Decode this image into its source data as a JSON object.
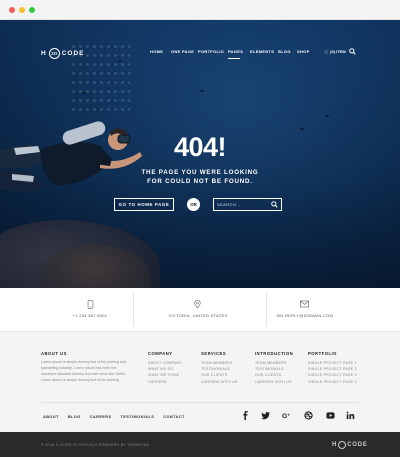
{
  "window": {
    "controls": [
      "close",
      "minimize",
      "maximize"
    ]
  },
  "colors": {
    "close": "#f25f58",
    "minimize": "#fbbe2e",
    "maximize": "#37c840",
    "accent": "#ffffff",
    "footer_bg": "#f4f4f4",
    "bottombar_bg": "#2a2a2a"
  },
  "header": {
    "logo_left": "H",
    "logo_mid": "2O",
    "logo_right": "CODE",
    "nav": [
      "HOME",
      "ONE PAGE",
      "PORTFOLIO",
      "PAGES",
      "ELEMENTS",
      "BLOG",
      "SHOP"
    ],
    "active_nav": "PAGES",
    "cart_label": "(0) ITEM"
  },
  "hero": {
    "title": "404!",
    "subtitle_line1": "THE PAGE YOU WERE LOOKING",
    "subtitle_line2": "FOR COULD NOT BE FOUND.",
    "home_button": "GO TO HOME PAGE",
    "or_label": "OR",
    "search_placeholder": "SEARCH..."
  },
  "contact": {
    "phone": "+1 234 567 8901",
    "address": "VICTORIA, UNITED STATES",
    "email": "NO-REPLY@DOMAIN.COM"
  },
  "footer": {
    "about_heading": "ABOUT US",
    "about_text": "Lorem Ipsum is simply dummy text of the printing and typesetting industry. Lorem Ipsum has been the industry's standard dummy text ever since the 1500s. Lorem Ipsum is simply dummy text of the printing",
    "columns": [
      {
        "heading": "COMPANY",
        "links": [
          "ABOUT COMPANY",
          "WHAT WE DO",
          "WHAT WE THINK",
          "CAREERS"
        ]
      },
      {
        "heading": "SERVICES",
        "links": [
          "TEAM MEMBERS",
          "TESTIMONIALS",
          "OUR CLIENTS",
          "CAREERS WITH US"
        ]
      },
      {
        "heading": "INTRODUCTION",
        "links": [
          "TEAM MEMBERS",
          "TESTIMONIALS",
          "OUR CLIENTS",
          "CAREERS WITH US"
        ]
      },
      {
        "heading": "PORTFOLIO",
        "links": [
          "SINGLE PROJECT PAGE 1",
          "SINGLE PROJECT PAGE 2",
          "SINGLE PROJECT PAGE 3",
          "SINGLE PROJECT PAGE 4"
        ]
      }
    ],
    "bottom_nav": [
      "ABOUT",
      "BLOG",
      "CAREERS",
      "TESTIMONIALS",
      "CONTACT"
    ],
    "socials": [
      "facebook-icon",
      "twitter-icon",
      "google-plus-icon",
      "dribbble-icon",
      "youtube-icon",
      "linkedin-icon"
    ],
    "copyright": "© 2016 H-CODE IS PROUDLY POWERED BY THEMEZAA",
    "logo_left": "H",
    "logo_right": "CODE"
  }
}
